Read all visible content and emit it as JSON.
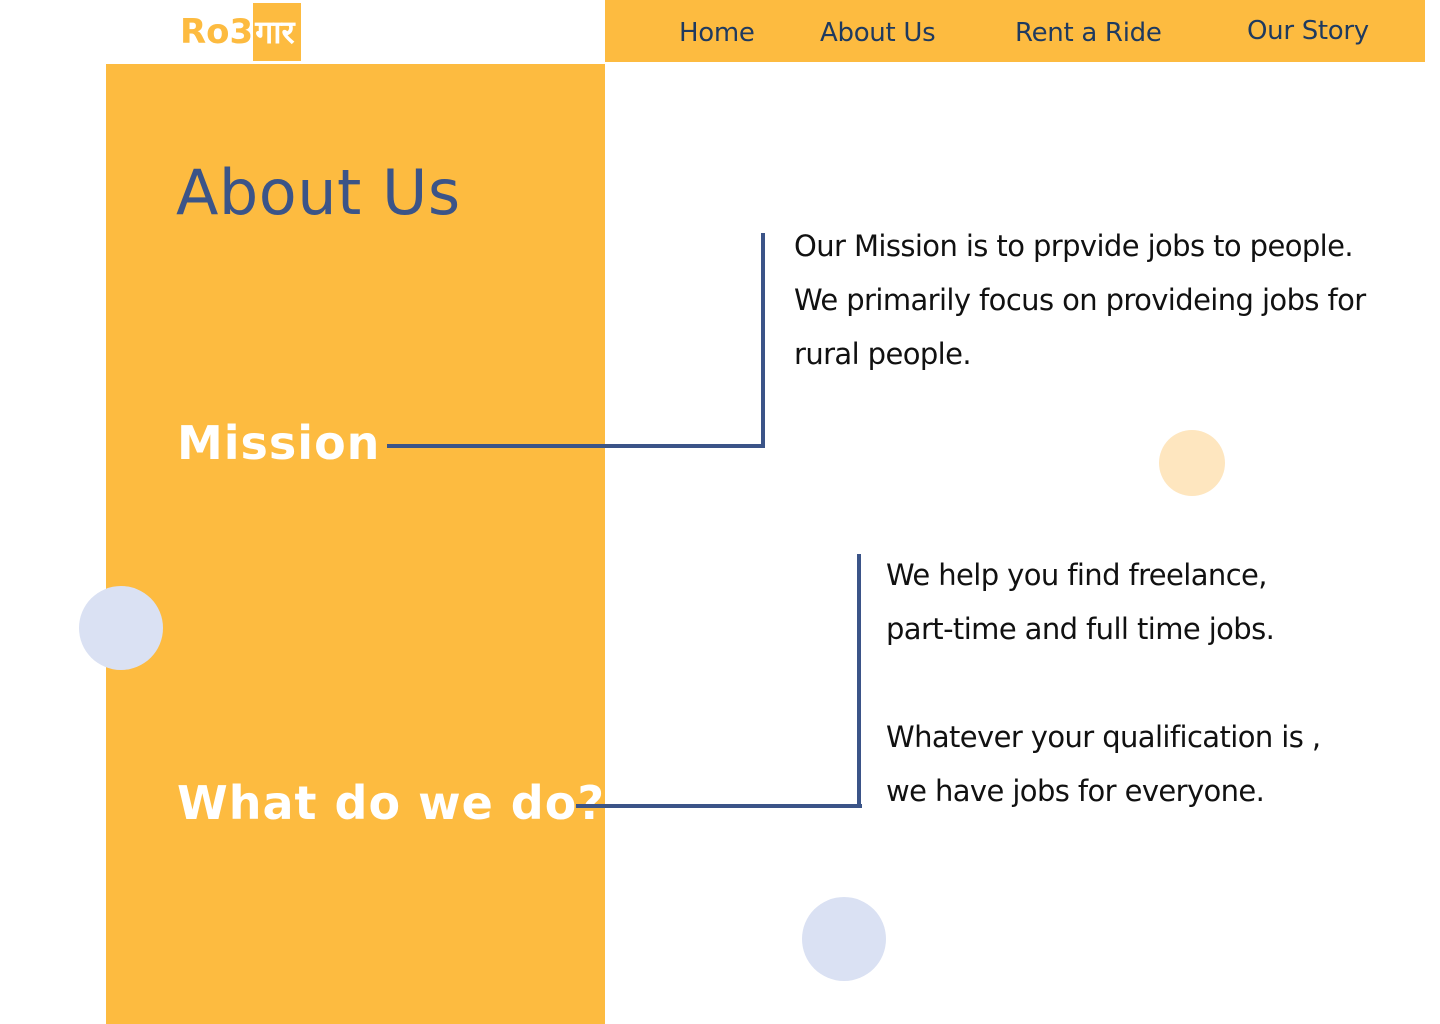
{
  "logo": {
    "latin_text": "Ro3",
    "devanagari_text": "गार"
  },
  "nav": {
    "items": [
      {
        "label": "Home"
      },
      {
        "label": "About Us"
      },
      {
        "label": "Rent a Ride"
      },
      {
        "label": "Our Story"
      }
    ]
  },
  "main": {
    "title": "About Us",
    "mission": {
      "heading": "Mission",
      "lines": [
        "Our Mission is to prpvide jobs to  people.",
        "We primarily focus on provideing jobs for",
        "rural people."
      ]
    },
    "what_we_do": {
      "heading": "What do we do?",
      "lines": [
        "We help you find freelance,",
        "part-time and full time jobs.",
        "",
        "Whatever your qualification is ,",
        "we have jobs for everyone."
      ]
    }
  },
  "colors": {
    "accent_yellow": "#FDBB40",
    "navy": "#3B5488",
    "nav_text": "#1F3A5F",
    "circle_peach": "#FEE6BF",
    "circle_lavender": "#DAE1F3"
  }
}
